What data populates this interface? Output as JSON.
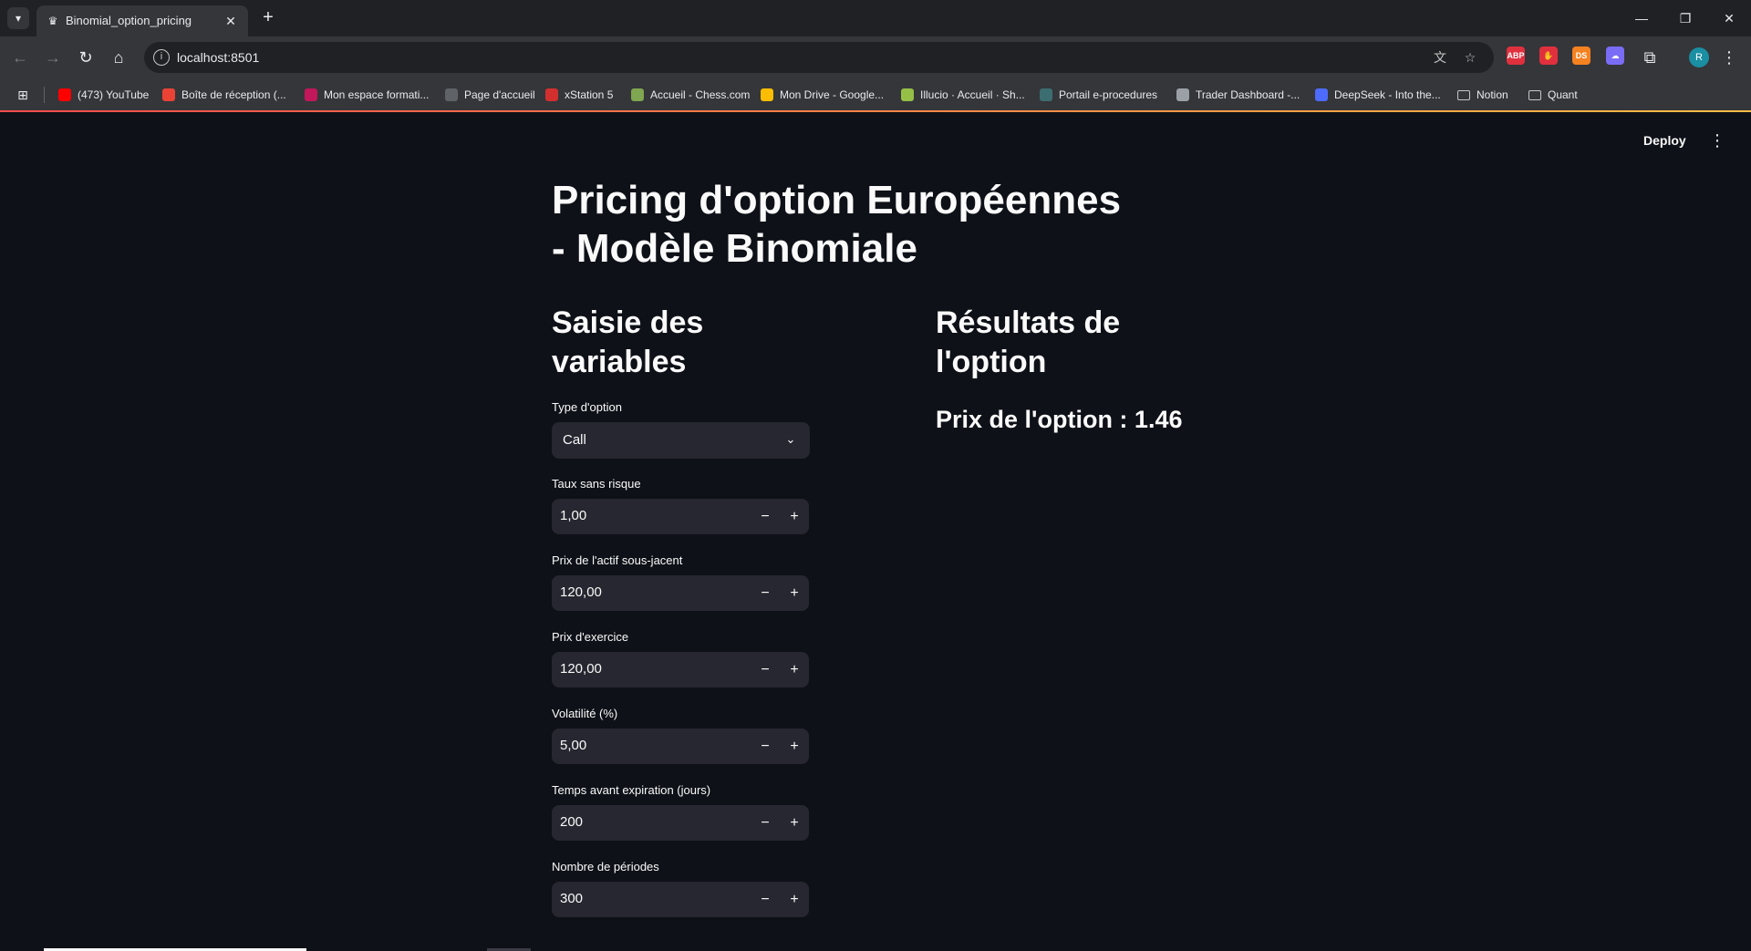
{
  "browser": {
    "tab_title": "Binomial_option_pricing",
    "url": "localhost:8501",
    "profile_initial": "R",
    "extensions": [
      {
        "name": "adblock-icon",
        "label": "ABP",
        "color": "#e0303e"
      },
      {
        "name": "hand-extension-icon",
        "label": "✋",
        "color": "#e0303e"
      },
      {
        "name": "ds-extension-icon",
        "label": "DS",
        "color": "#f58220"
      },
      {
        "name": "chat-extension-icon",
        "label": "☁",
        "color": "#7b6cf6"
      }
    ],
    "bookmarks": [
      {
        "label": "(473) YouTube",
        "icon": "youtube-icon",
        "color": "#ff0000"
      },
      {
        "label": "Boîte de réception (...",
        "icon": "gmail-icon",
        "color": "#ea4335"
      },
      {
        "label": "Mon espace formati...",
        "icon": "un-icon",
        "color": "#c2185b"
      },
      {
        "label": "Page d'accueil",
        "icon": "globe-icon",
        "color": "#5f6368"
      },
      {
        "label": "xStation 5",
        "icon": "xstation-icon",
        "color": "#d32f2f"
      },
      {
        "label": "Accueil - Chess.com",
        "icon": "chess-icon",
        "color": "#7fa650"
      },
      {
        "label": "Mon Drive - Google...",
        "icon": "drive-icon",
        "color": "#fbbc04"
      },
      {
        "label": "Illucio · Accueil · Sh...",
        "icon": "shopify-icon",
        "color": "#95bf47"
      },
      {
        "label": "Portail e-procedures",
        "icon": "portal-icon",
        "color": "#3c6e71"
      },
      {
        "label": "Trader Dashboard -...",
        "icon": "dashboard-icon",
        "color": "#9aa0a6"
      },
      {
        "label": "DeepSeek - Into the...",
        "icon": "deepseek-icon",
        "color": "#4d6bfe"
      },
      {
        "label": "Notion",
        "icon": "folder-icon",
        "color": "transparent"
      },
      {
        "label": "Quant",
        "icon": "folder-icon",
        "color": "transparent"
      }
    ]
  },
  "app": {
    "deploy_label": "Deploy",
    "title": "Pricing d'option Européennes - Modèle Binomiale",
    "inputs_heading": "Saisie des variables",
    "results_heading": "Résultats de l'option",
    "result_text": "Prix de l'option : 1.46",
    "option_type": {
      "label": "Type d'option",
      "value": "Call"
    },
    "number_inputs": [
      {
        "label": "Taux sans risque",
        "value": "1,00"
      },
      {
        "label": "Prix de l'actif sous-jacent",
        "value": "120,00"
      },
      {
        "label": "Prix d'exercice",
        "value": "120,00"
      },
      {
        "label": "Volatilité (%)",
        "value": "5,00"
      },
      {
        "label": "Temps avant expiration (jours)",
        "value": "200"
      },
      {
        "label": "Nombre de périodes",
        "value": "300"
      }
    ]
  }
}
